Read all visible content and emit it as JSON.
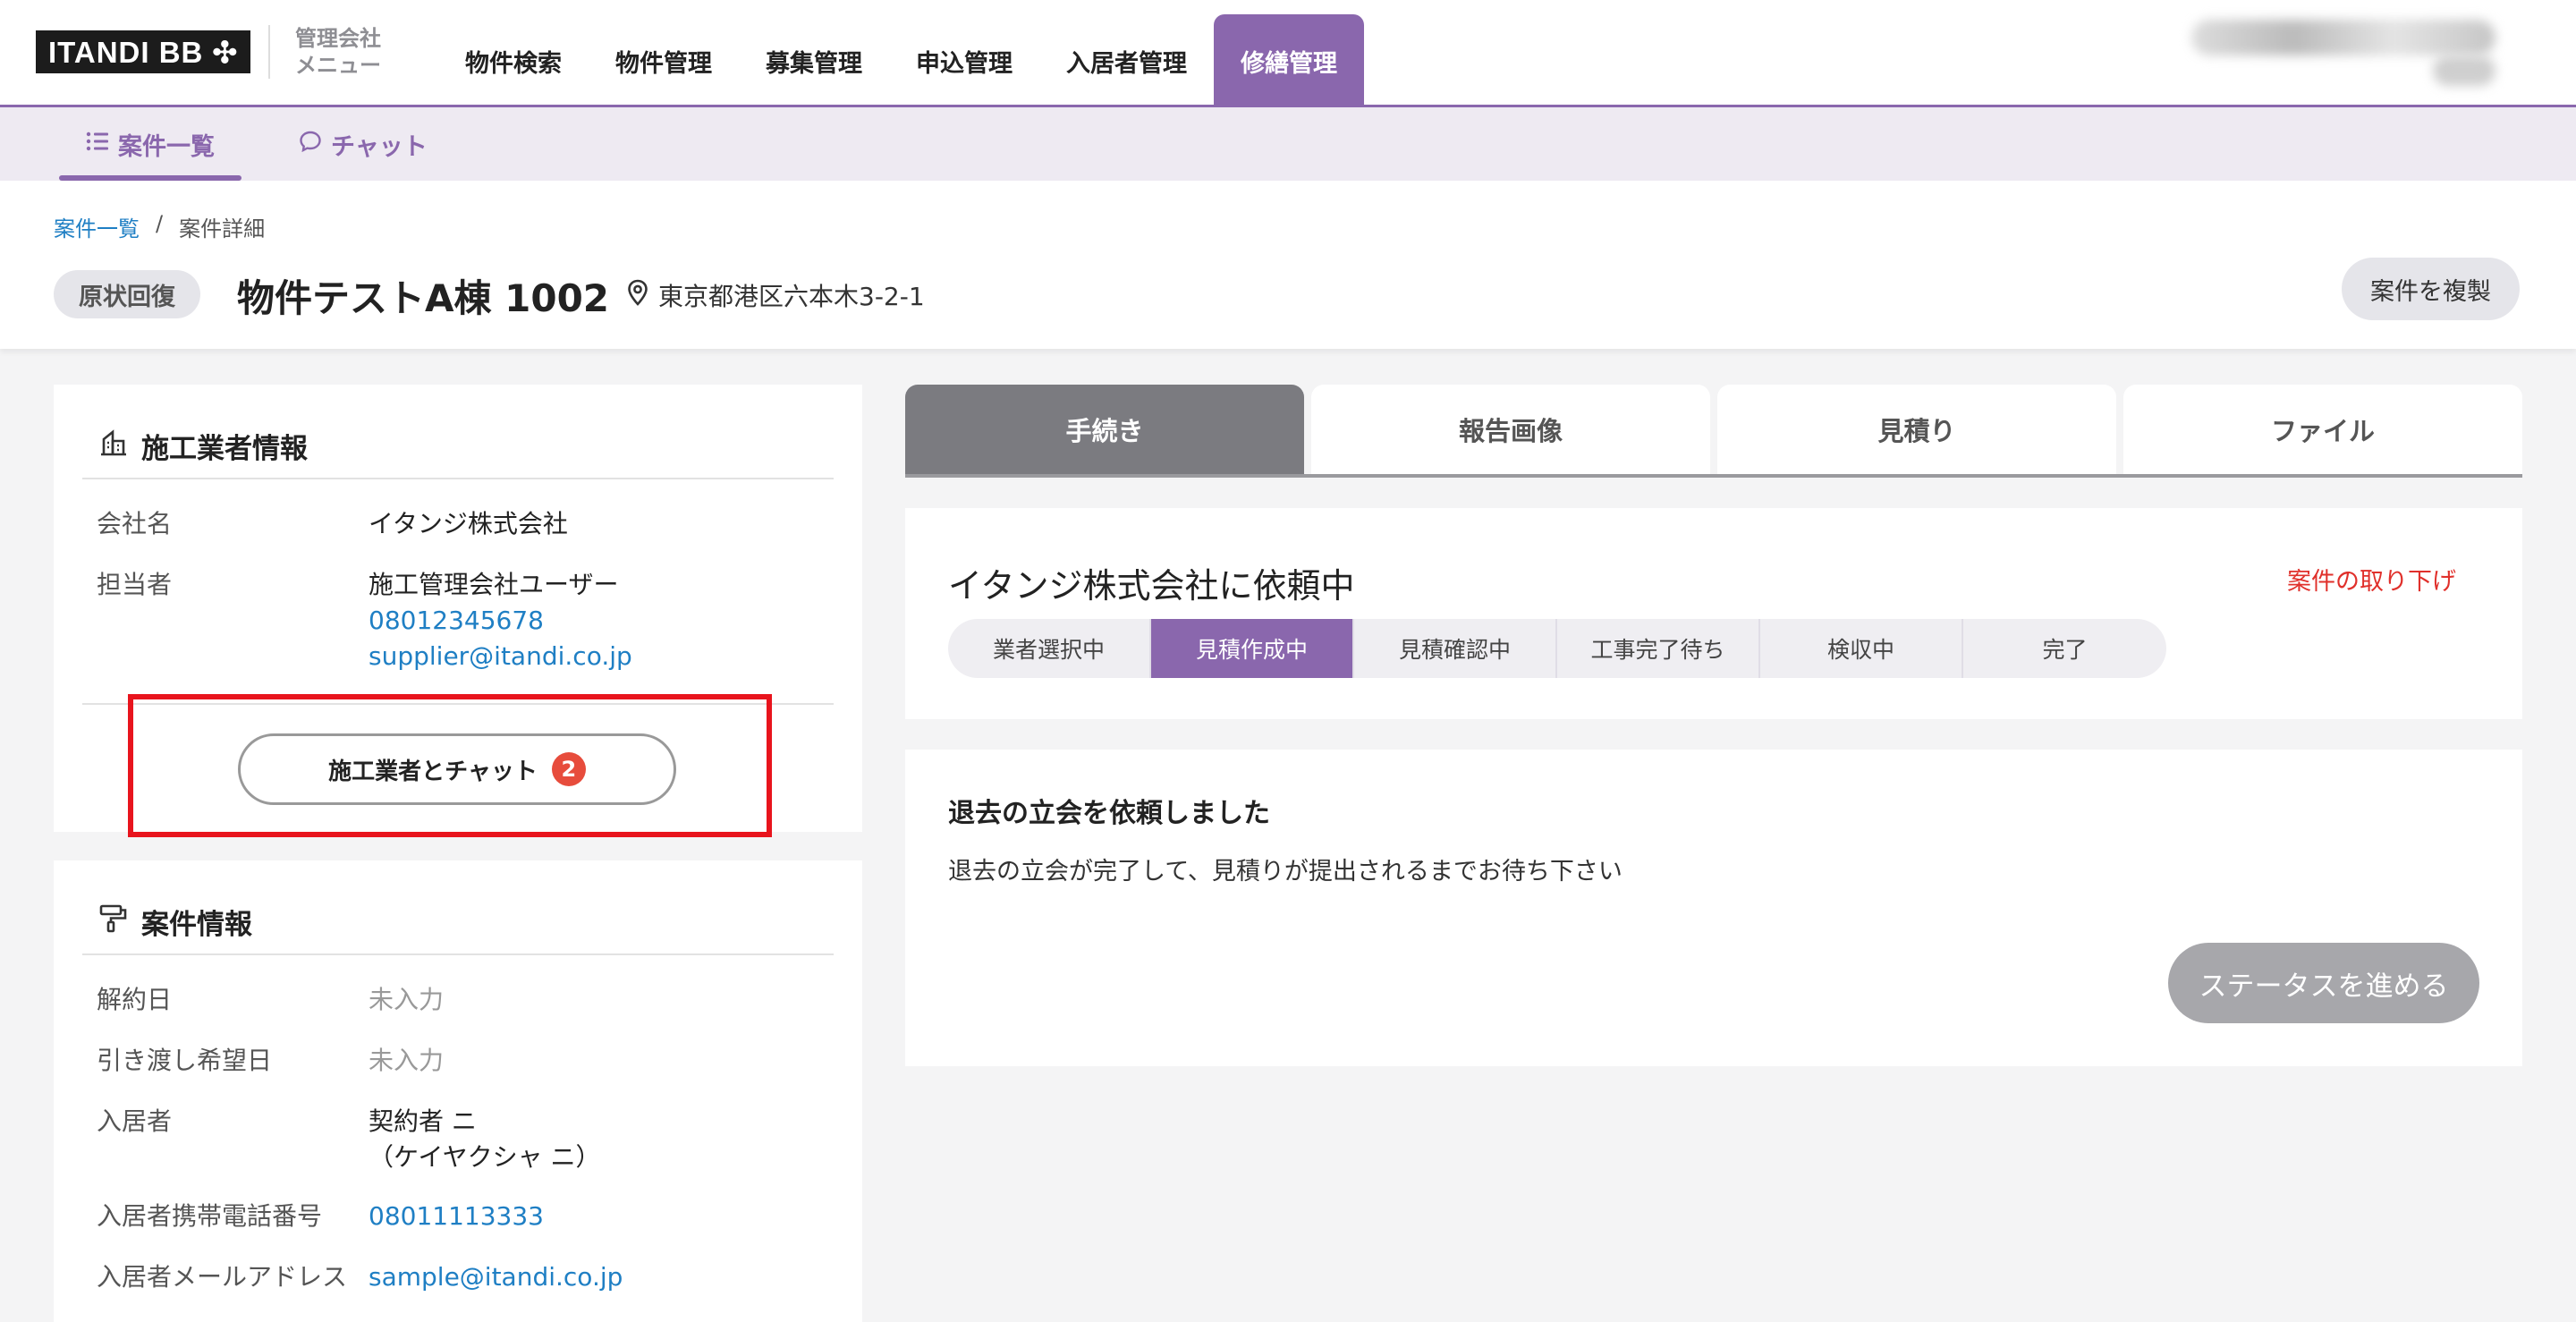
{
  "header": {
    "logo": "ITANDI BB ✣",
    "admin_menu_line1": "管理会社",
    "admin_menu_line2": "メニュー",
    "nav": [
      "物件検索",
      "物件管理",
      "募集管理",
      "申込管理",
      "入居者管理",
      "修繕管理"
    ],
    "active_nav": "修繕管理"
  },
  "subnav": {
    "list_label": "案件一覧",
    "chat_label": "チャット"
  },
  "page": {
    "breadcrumb_root": "案件一覧",
    "breadcrumb_sep": "/",
    "breadcrumb_current": "案件詳細",
    "type_badge": "原状回復",
    "property_title": "物件テストA棟 1002",
    "address": "東京都港区六本木3-2-1",
    "duplicate_button": "案件を複製"
  },
  "contractor": {
    "section_title": "施工業者情報",
    "company_label": "会社名",
    "company_value": "イタンジ株式会社",
    "person_label": "担当者",
    "person_name": "施工管理会社ユーザー",
    "person_phone": "08012345678",
    "person_email": "supplier@itandi.co.jp",
    "chat_button": "施工業者とチャット",
    "chat_unread": "2"
  },
  "case_info": {
    "section_title": "案件情報",
    "rows": [
      {
        "label": "解約日",
        "value": "未入力"
      },
      {
        "label": "引き渡し希望日",
        "value": "未入力"
      },
      {
        "label": "入居者",
        "value": "契約者 ニ",
        "value2": "（ケイヤクシャ ニ）"
      },
      {
        "label": "入居者携帯電話番号",
        "value": "08011113333"
      },
      {
        "label": "入居者メールアドレス",
        "value": "sample@itandi.co.jp"
      }
    ]
  },
  "tabs": [
    "手続き",
    "報告画像",
    "見積り",
    "ファイル"
  ],
  "active_tab": "手続き",
  "status": {
    "title": "イタンジ株式会社に依頼中",
    "withdraw_link": "案件の取り下げ",
    "steps": [
      "業者選択中",
      "見積作成中",
      "見積確認中",
      "工事完了待ち",
      "検収中",
      "完了"
    ],
    "current_step": "見積作成中"
  },
  "message": {
    "title": "退去の立会を依頼しました",
    "body": "退去の立会が完了して、見積りが提出されるまでお待ち下さい",
    "advance_button": "ステータスを進める"
  },
  "colors": {
    "brand_purple": "#8a67ad",
    "link_blue": "#1f7fc4",
    "alert_red": "#e0302b",
    "highlight_red": "#e8141d"
  }
}
